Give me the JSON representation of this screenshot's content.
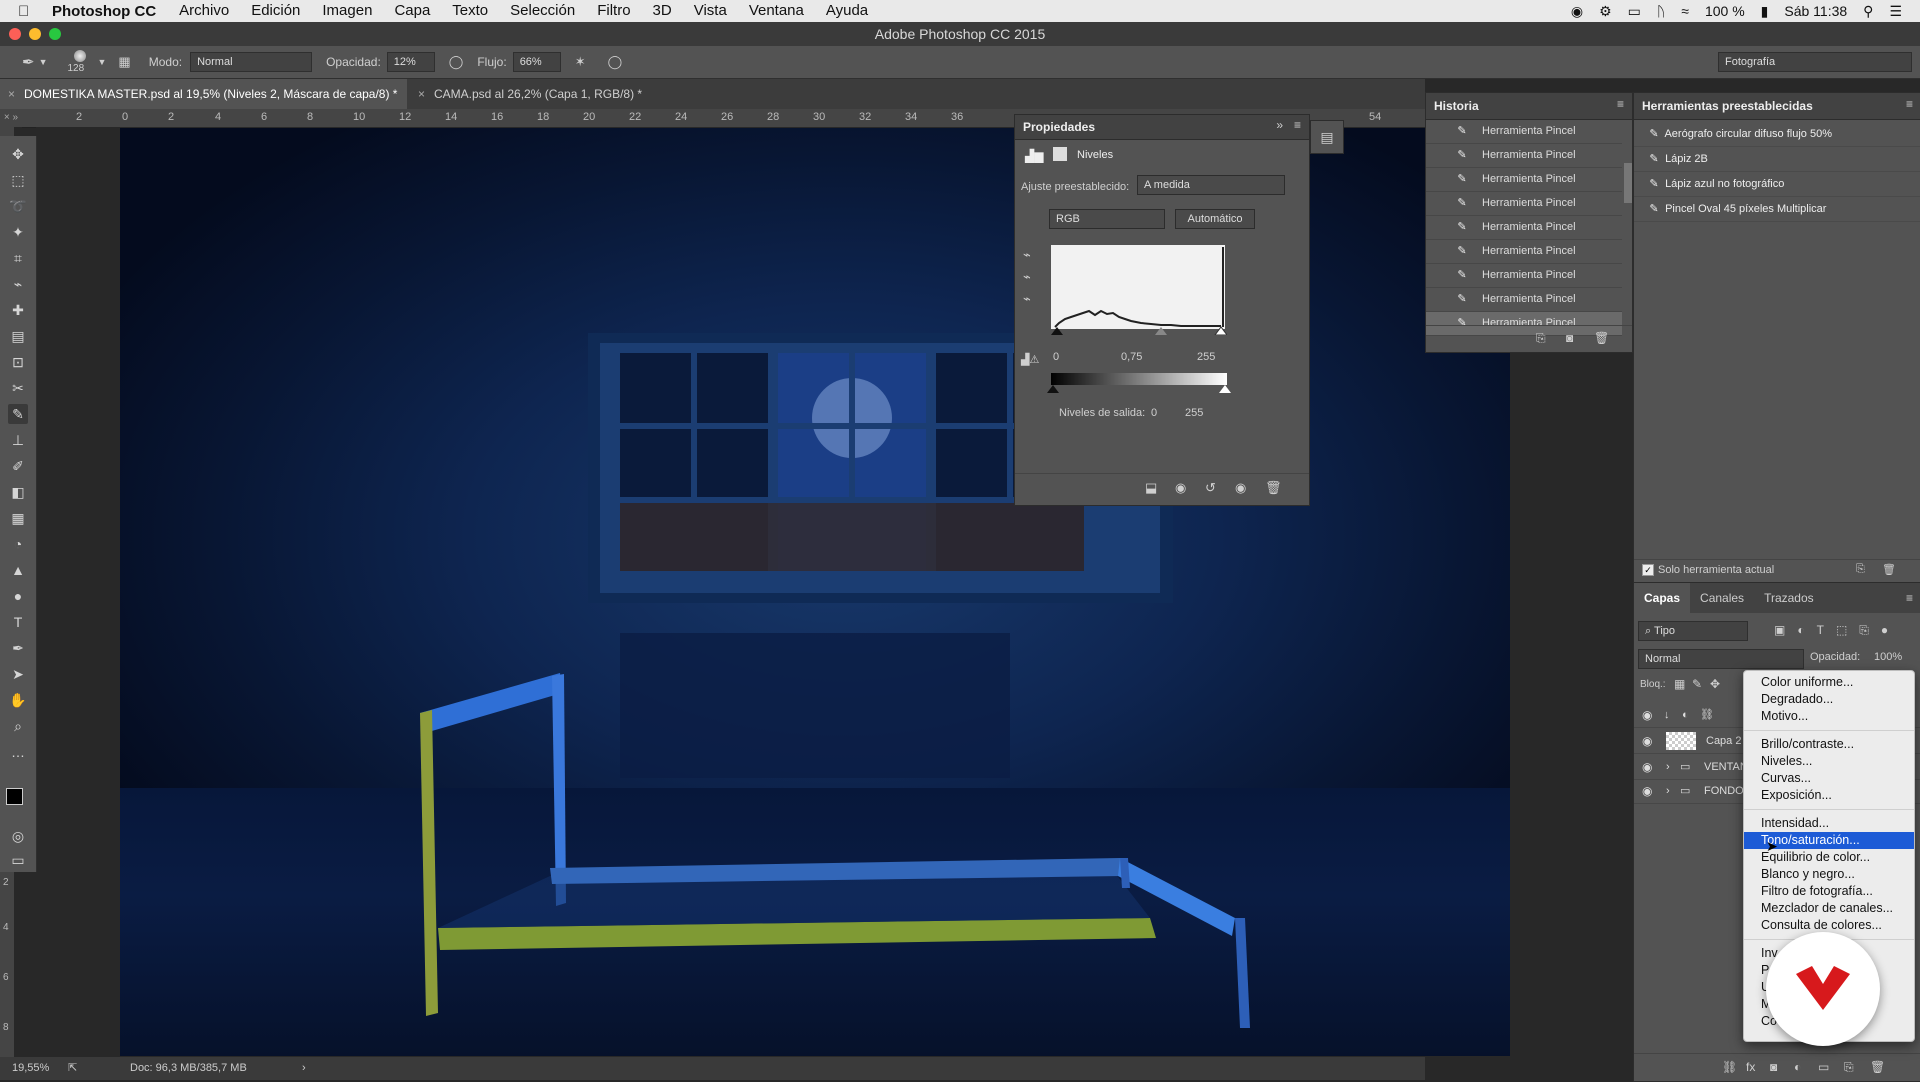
{
  "menubar": {
    "app": "Photoshop CC",
    "items": [
      "Archivo",
      "Edición",
      "Imagen",
      "Capa",
      "Texto",
      "Selección",
      "Filtro",
      "3D",
      "Vista",
      "Ventana",
      "Ayuda"
    ],
    "battery": "100 %",
    "clock": "Sáb 11:38"
  },
  "window": {
    "title": "Adobe Photoshop CC 2015"
  },
  "options": {
    "brush_size": "128",
    "mode_label": "Modo:",
    "mode_value": "Normal",
    "opacity_label": "Opacidad:",
    "opacity_value": "12%",
    "flow_label": "Flujo:",
    "flow_value": "66%",
    "workspace": "Fotografía"
  },
  "tabs": [
    {
      "label": "DOMESTIKA MASTER.psd al 19,5% (Niveles 2, Máscara de capa/8) *"
    },
    {
      "label": "CAMA.psd al 26,2% (Capa 1, RGB/8) *"
    }
  ],
  "ruler": [
    "2",
    "0",
    "2",
    "4",
    "6",
    "8",
    "10",
    "12",
    "14",
    "16",
    "18",
    "20",
    "22",
    "24",
    "26",
    "28",
    "30",
    "32",
    "34",
    "36",
    "54"
  ],
  "vruler": [
    "2",
    "4",
    "6",
    "8"
  ],
  "properties": {
    "title": "Propiedades",
    "adjustment": "Niveles",
    "preset_label": "Ajuste preestablecido:",
    "preset_value": "A medida",
    "channel": "RGB",
    "auto": "Automático",
    "input": [
      "0",
      "0,75",
      "255"
    ],
    "output_label": "Niveles de salida:",
    "output": [
      "0",
      "255"
    ]
  },
  "history": {
    "title": "Historia",
    "items": [
      "Herramienta Pincel",
      "Herramienta Pincel",
      "Herramienta Pincel",
      "Herramienta Pincel",
      "Herramienta Pincel",
      "Herramienta Pincel",
      "Herramienta Pincel",
      "Herramienta Pincel",
      "Herramienta Pincel"
    ],
    "current_index": 8
  },
  "presets": {
    "title": "Herramientas preestablecidas",
    "items": [
      "Aerógrafo circular difuso flujo 50%",
      "Lápiz 2B",
      "Lápiz azul no fotográfico",
      "Pincel Oval 45 píxeles Multiplicar"
    ],
    "only_current": "Solo herramienta actual"
  },
  "layers": {
    "tabs": [
      "Capas",
      "Canales",
      "Trazados"
    ],
    "filter": "Tipo",
    "blend": "Normal",
    "opacity_label": "Opacidad:",
    "opacity": "100%",
    "lock_label": "Bloq.:",
    "rows": [
      "",
      "Capa 2",
      "VENTAN",
      "FONDO"
    ]
  },
  "context_menu": {
    "groups": [
      [
        "Color uniforme...",
        "Degradado...",
        "Motivo..."
      ],
      [
        "Brillo/contraste...",
        "Niveles...",
        "Curvas...",
        "Exposición..."
      ],
      [
        "Intensidad...",
        "Tono/saturación...",
        "Equilibrio de color...",
        "Blanco y negro...",
        "Filtro de fotografía...",
        "Mezclador de canales...",
        "Consulta de colores..."
      ],
      [
        "Inv",
        "P",
        "U",
        "M",
        "Co"
      ]
    ],
    "highlighted": "Tono/saturación..."
  },
  "status": {
    "zoom": "19,55%",
    "doc": "Doc: 96,3 MB/385,7 MB"
  },
  "colors": {
    "accent": "#1d5bd6",
    "canvas_blue": "#0e2550",
    "bed_blue": "#2f6fd6",
    "bed_yellow": "#9aa43c",
    "logo_red": "#d7191c"
  }
}
